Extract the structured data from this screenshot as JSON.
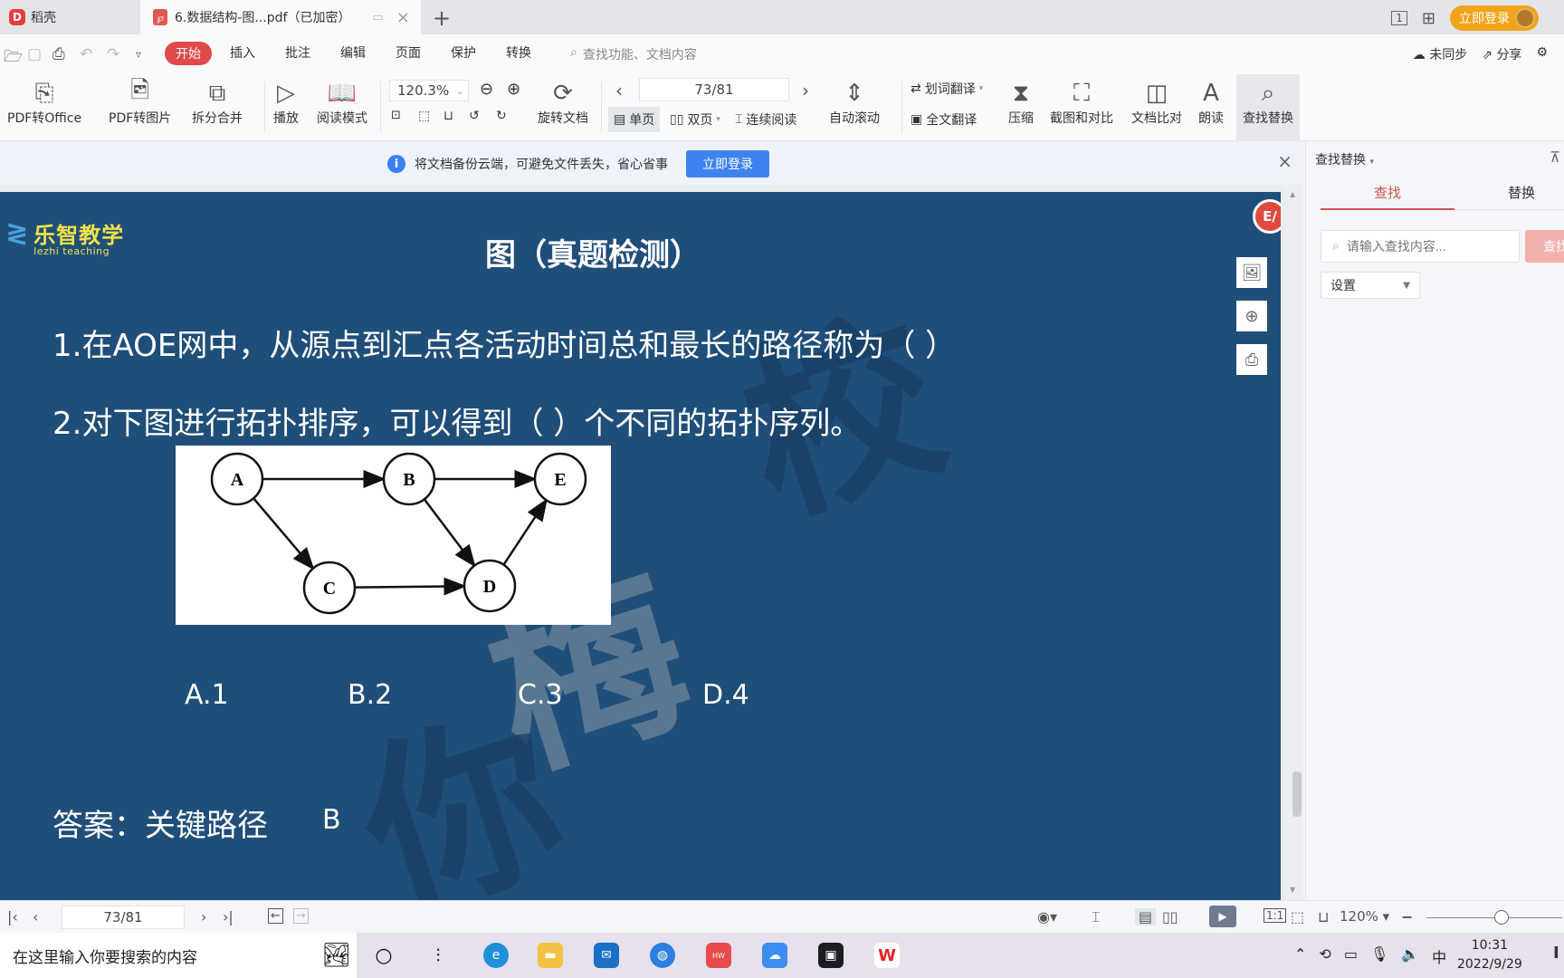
{
  "tabs": {
    "home_label": "稻壳",
    "doc_label": "6.数据结构-图...pdf（已加密）"
  },
  "titlebar": {
    "page_indicator": "1",
    "login_label": "立即登录"
  },
  "menu": {
    "items": [
      "开始",
      "插入",
      "批注",
      "编辑",
      "页面",
      "保护",
      "转换"
    ],
    "search_placeholder": "查找功能、文档内容",
    "sync_label": "未同步",
    "share_label": "分享"
  },
  "ribbon": {
    "pdf_to_office": "PDF转Office",
    "pdf_to_image": "PDF转图片",
    "split_merge": "拆分合并",
    "play": "播放",
    "read_mode": "阅读模式",
    "zoom_value": "120.3%",
    "rotate_doc": "旋转文档",
    "page_value": "73/81",
    "single_page": "单页",
    "double_page": "双页",
    "continuous": "连续阅读",
    "auto_scroll": "自动滚动",
    "word_translate": "划词翻译",
    "full_translate": "全文翻译",
    "compress": "压缩",
    "screenshot_compare": "截图和对比",
    "doc_compare": "文档比对",
    "read_aloud": "朗读",
    "find_replace": "查找替换"
  },
  "notify": {
    "message": "将文档备份云端，可避免文件丢失，省心省事",
    "login_button": "立即登录"
  },
  "slide": {
    "brand_cn": "乐智教学",
    "brand_en": "lezhi teaching",
    "title": "图（真题检测）",
    "q1": "1.在AOE网中，从源点到汇点各活动时间总和最长的路径称为（   ）",
    "q2": "2.对下图进行拓扑排序，可以得到（  ）个不同的拓扑序列。",
    "graph": {
      "nodes": [
        "A",
        "B",
        "C",
        "D",
        "E"
      ],
      "edges": [
        [
          "A",
          "B"
        ],
        [
          "A",
          "C"
        ],
        [
          "B",
          "E"
        ],
        [
          "B",
          "D"
        ],
        [
          "C",
          "D"
        ],
        [
          "D",
          "E"
        ]
      ]
    },
    "options": [
      "A.1",
      "B.2",
      "C.3",
      "D.4"
    ],
    "answer_label": "答案：关键路径",
    "answer_choice": "B"
  },
  "right_panel": {
    "title": "查找替换",
    "tab_find": "查找",
    "tab_replace": "替换",
    "search_placeholder": "请输入查找内容...",
    "search_value": "",
    "find_button": "查找",
    "settings_label": "设置"
  },
  "status": {
    "page_value": "73/81",
    "zoom_label": "120%",
    "zoom_fraction": 0.55
  },
  "taskbar": {
    "search_placeholder": "在这里输入你要搜索的内容",
    "ime": "中",
    "time": "10:31",
    "date": "2022/9/29"
  }
}
